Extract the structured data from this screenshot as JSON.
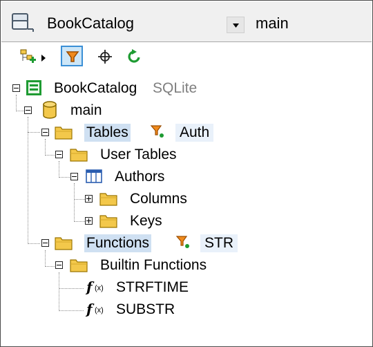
{
  "selector": {
    "database": "BookCatalog",
    "schema": "main"
  },
  "tree": {
    "root": {
      "label": "BookCatalog",
      "kind": "SQLite"
    },
    "schema": {
      "label": "main"
    },
    "tables": {
      "label": "Tables",
      "filter": "Auth"
    },
    "user_tables": {
      "label": "User Tables"
    },
    "authors": {
      "label": "Authors"
    },
    "columns": {
      "label": "Columns"
    },
    "keys": {
      "label": "Keys"
    },
    "functions": {
      "label": "Functions",
      "filter": "STR"
    },
    "builtin_functions": {
      "label": "Builtin Functions"
    },
    "func_items": [
      {
        "label": "STRFTIME"
      },
      {
        "label": "SUBSTR"
      }
    ]
  },
  "colors": {
    "highlight": "#cfe0f2",
    "folder": "#f3c84b",
    "accent": "#3a8fd6",
    "green": "#1e9b32"
  }
}
